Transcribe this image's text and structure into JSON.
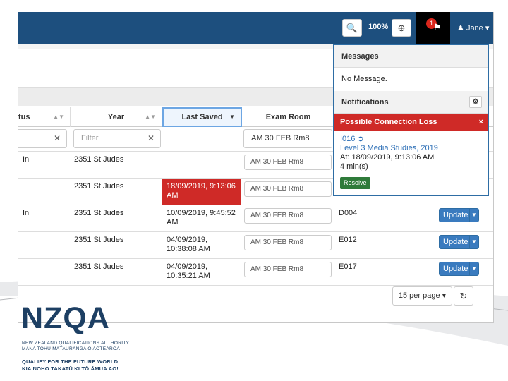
{
  "toolbar": {
    "zoom_out_icon": "zoom-out-icon",
    "zoom_level": "100%",
    "zoom_in_icon": "zoom-in-icon",
    "notification_count": "1",
    "user_name": "Jane",
    "user_caret": "▾"
  },
  "table": {
    "headers": [
      {
        "label": "tus"
      },
      {
        "label": "Year"
      },
      {
        "label": "Last Saved"
      },
      {
        "label": "Exam Room"
      }
    ],
    "filters": {
      "year_placeholder": "Filter",
      "exam_room_value": "AM 30 FEB Rm8"
    },
    "rows": [
      {
        "status": "In",
        "year": "2351 St Judes",
        "last_saved": "",
        "exam_room": "AM 30 FEB Rm8",
        "room": "",
        "action": ""
      },
      {
        "status": "",
        "year": "2351 St Judes",
        "last_saved": "18/09/2019, 9:13:06 AM",
        "exam_room": "AM 30 FEB Rm8",
        "room": "",
        "action": ""
      },
      {
        "status": "In",
        "year": "2351 St Judes",
        "last_saved": "10/09/2019, 9:45:52 AM",
        "exam_room": "AM 30 FEB Rm8",
        "room": "D004",
        "action": "Update"
      },
      {
        "status": "",
        "year": "2351 St Judes",
        "last_saved": "04/09/2019, 10:38:08 AM",
        "exam_room": "AM 30 FEB Rm8",
        "room": "E012",
        "action": "Update"
      },
      {
        "status": "",
        "year": "2351 St Judes",
        "last_saved": "04/09/2019, 10:35:21 AM",
        "exam_room": "AM 30 FEB Rm8",
        "room": "E017",
        "action": "Update"
      }
    ]
  },
  "pagination": {
    "per_page": "15 per page ▾",
    "refresh_icon": "refresh-icon"
  },
  "panel": {
    "messages_title": "Messages",
    "messages_body": "No Message.",
    "notifications_title": "Notifications",
    "alert_title": "Possible Connection Loss",
    "alert_close": "×",
    "alert_id": "I016",
    "alert_course": "Level 3 Media Studies, 2019",
    "alert_time": "At: 18/09/2019, 9:13:06 AM",
    "alert_duration": "4 min(s)",
    "resolve_label": "Resolve"
  },
  "branding": {
    "logo": "NZQA",
    "line1": "NEW ZEALAND QUALIFICATIONS AUTHORITY",
    "line2": "MANA TOHU MĀTAURANGA O AOTEAROA",
    "tagline1": "QUALIFY FOR THE FUTURE WORLD",
    "tagline2": "KIA NOHO TAKATŪ KI TŌ ĀMUA AO!"
  },
  "colors": {
    "topbar": "#1d4f7e",
    "alert": "#cf2a27",
    "resolve": "#2f7b3a",
    "update": "#3a7bbf"
  }
}
